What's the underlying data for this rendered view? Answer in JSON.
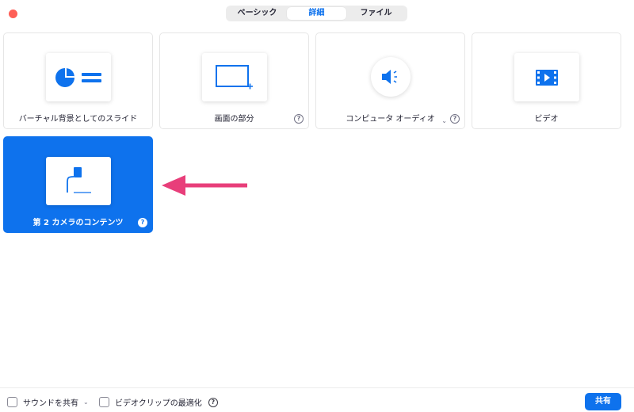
{
  "window": {
    "close_color": "#fe5f57"
  },
  "tabs": [
    {
      "label": "ベーシック",
      "active": false
    },
    {
      "label": "詳細",
      "active": true
    },
    {
      "label": "ファイル",
      "active": false
    }
  ],
  "cards": [
    {
      "label": "バーチャル背景としてのスライド",
      "icon": "slides-icon"
    },
    {
      "label": "画面の部分",
      "icon": "screen-portion-icon",
      "help": "?"
    },
    {
      "label": "コンピュータ オーディオ",
      "icon": "speaker-icon",
      "help": "?",
      "dropdown": "⌄"
    },
    {
      "label": "ビデオ",
      "icon": "video-file-icon"
    },
    {
      "label": "第 2 カメラのコンテンツ",
      "icon": "document-camera-icon",
      "help": "?",
      "selected": true
    }
  ],
  "annotation": {
    "icon": "arrow-left-icon",
    "color": "#e83e7a"
  },
  "footer": {
    "share_sound_label": "サウンドを共有",
    "share_sound_dropdown": "⌄",
    "optimize_video_label": "ビデオクリップの最適化",
    "help": "?",
    "share_button": "共有"
  },
  "colors": {
    "accent": "#0e72ed",
    "card_border": "#e6e6e6"
  }
}
